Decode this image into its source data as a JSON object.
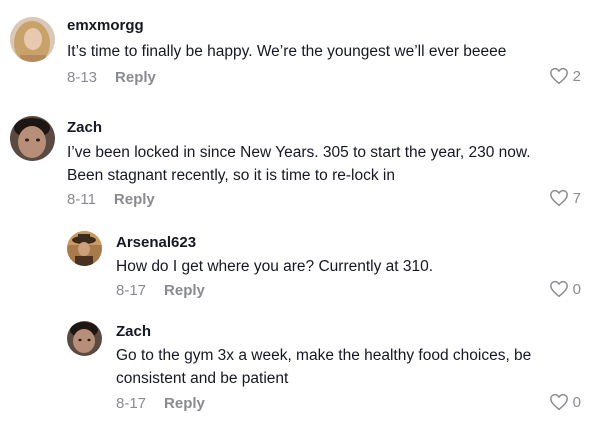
{
  "comments": [
    {
      "username": "emxmorgg",
      "text_lines": [
        "It’s time to finally be happy. We’re the youngest we’ll ever beeee"
      ],
      "date": "8-13",
      "reply_label": "Reply",
      "likes": "2",
      "avatar_icon": "user-avatar-blonde"
    },
    {
      "username": "Zach",
      "text_lines": [
        "I’ve been locked in since New Years. 305 to start the year, 230 now.",
        "Been stagnant recently, so it is time to re-lock in"
      ],
      "date": "8-11",
      "reply_label": "Reply",
      "likes": "7",
      "avatar_icon": "user-avatar-dark-hair"
    },
    {
      "username": "Arsenal623",
      "text_lines": [
        "How do I get where you are? Currently at 310."
      ],
      "date": "8-17",
      "reply_label": "Reply",
      "likes": "0",
      "avatar_icon": "user-avatar-cowboy"
    },
    {
      "username": "Zach",
      "text_lines": [
        "Go to the gym 3x a week, make the healthy food choices, be",
        "consistent and be patient"
      ],
      "date": "8-17",
      "reply_label": "Reply",
      "likes": "0",
      "avatar_icon": "user-avatar-dark-hair"
    }
  ],
  "colors": {
    "username": "#161823",
    "meta": "#8a8b91"
  }
}
